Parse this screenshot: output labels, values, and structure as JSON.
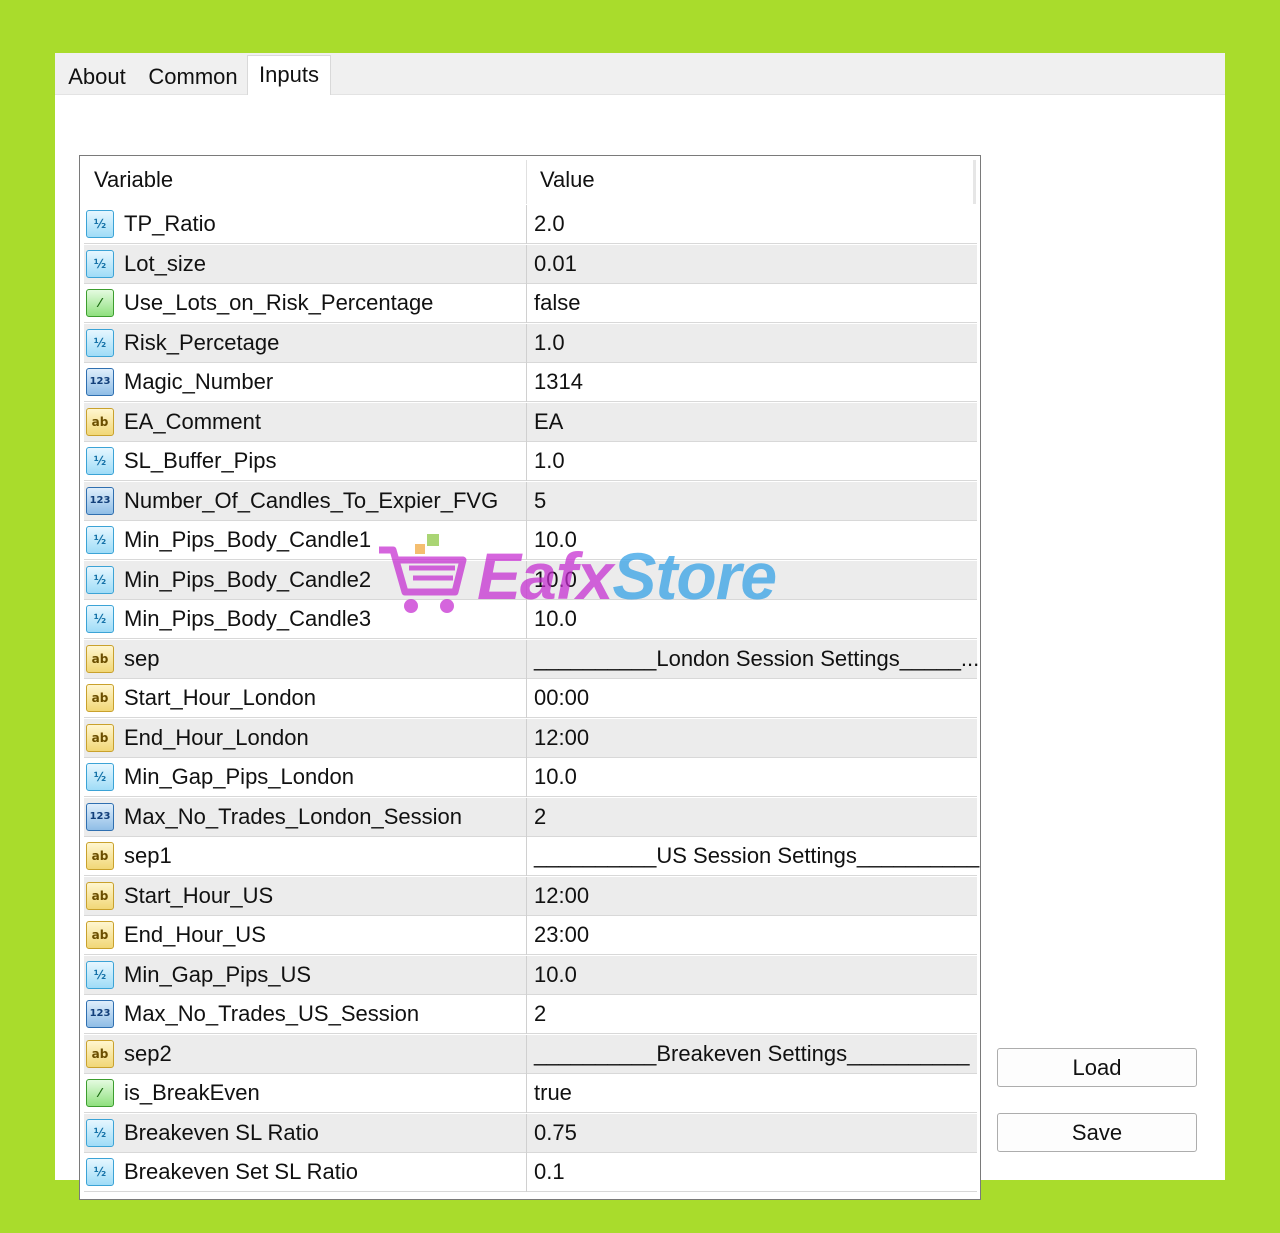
{
  "tabs": [
    {
      "label": "About"
    },
    {
      "label": "Common"
    },
    {
      "label": "Inputs",
      "active": true
    }
  ],
  "table": {
    "headers": {
      "variable": "Variable",
      "value": "Value"
    },
    "rows": [
      {
        "icon": "double-icon",
        "type": "dbl",
        "glyph": "½",
        "name": "TP_Ratio",
        "value": "2.0"
      },
      {
        "icon": "double-icon",
        "type": "dbl",
        "glyph": "½",
        "name": "Lot_size",
        "value": "0.01"
      },
      {
        "icon": "bool-icon",
        "type": "bool",
        "glyph": "⁄",
        "name": "Use_Lots_on_Risk_Percentage",
        "value": "false"
      },
      {
        "icon": "double-icon",
        "type": "dbl",
        "glyph": "½",
        "name": "Risk_Percetage",
        "value": "1.0"
      },
      {
        "icon": "integer-icon",
        "type": "intg",
        "glyph": "123",
        "name": "Magic_Number",
        "value": "1314"
      },
      {
        "icon": "string-icon",
        "type": "str",
        "glyph": "ab",
        "name": "EA_Comment",
        "value": "EA"
      },
      {
        "icon": "double-icon",
        "type": "dbl",
        "glyph": "½",
        "name": "SL_Buffer_Pips",
        "value": "1.0"
      },
      {
        "icon": "integer-icon",
        "type": "intg",
        "glyph": "123",
        "name": "Number_Of_Candles_To_Expier_FVG",
        "value": "5"
      },
      {
        "icon": "double-icon",
        "type": "dbl",
        "glyph": "½",
        "name": "Min_Pips_Body_Candle1",
        "value": "10.0"
      },
      {
        "icon": "double-icon",
        "type": "dbl",
        "glyph": "½",
        "name": "Min_Pips_Body_Candle2",
        "value": "10.0"
      },
      {
        "icon": "double-icon",
        "type": "dbl",
        "glyph": "½",
        "name": "Min_Pips_Body_Candle3",
        "value": "10.0"
      },
      {
        "icon": "string-icon",
        "type": "str",
        "glyph": "ab",
        "name": "sep",
        "value": "__________London Session Settings_____..."
      },
      {
        "icon": "string-icon",
        "type": "str",
        "glyph": "ab",
        "name": "Start_Hour_London",
        "value": "00:00"
      },
      {
        "icon": "string-icon",
        "type": "str",
        "glyph": "ab",
        "name": "End_Hour_London",
        "value": "12:00"
      },
      {
        "icon": "double-icon",
        "type": "dbl",
        "glyph": "½",
        "name": "Min_Gap_Pips_London",
        "value": "10.0"
      },
      {
        "icon": "integer-icon",
        "type": "intg",
        "glyph": "123",
        "name": "Max_No_Trades_London_Session",
        "value": "2"
      },
      {
        "icon": "string-icon",
        "type": "str",
        "glyph": "ab",
        "name": "sep1",
        "value": "__________US Session Settings__________"
      },
      {
        "icon": "string-icon",
        "type": "str",
        "glyph": "ab",
        "name": "Start_Hour_US",
        "value": "12:00"
      },
      {
        "icon": "string-icon",
        "type": "str",
        "glyph": "ab",
        "name": "End_Hour_US",
        "value": "23:00"
      },
      {
        "icon": "double-icon",
        "type": "dbl",
        "glyph": "½",
        "name": "Min_Gap_Pips_US",
        "value": "10.0"
      },
      {
        "icon": "integer-icon",
        "type": "intg",
        "glyph": "123",
        "name": "Max_No_Trades_US_Session",
        "value": "2"
      },
      {
        "icon": "string-icon",
        "type": "str",
        "glyph": "ab",
        "name": "sep2",
        "value": "__________Breakeven Settings__________"
      },
      {
        "icon": "bool-icon",
        "type": "bool",
        "glyph": "⁄",
        "name": "is_BreakEven",
        "value": "true"
      },
      {
        "icon": "double-icon",
        "type": "dbl",
        "glyph": "½",
        "name": "Breakeven SL Ratio",
        "value": "0.75"
      },
      {
        "icon": "double-icon",
        "type": "dbl",
        "glyph": "½",
        "name": "Breakeven Set SL Ratio",
        "value": "0.1"
      }
    ]
  },
  "buttons": {
    "load": "Load",
    "save": "Save"
  },
  "watermark": {
    "part1": "Eafx",
    "part2": "Store"
  },
  "colors": {
    "background": "#a9dc2c",
    "row_alt": "#ececec"
  }
}
